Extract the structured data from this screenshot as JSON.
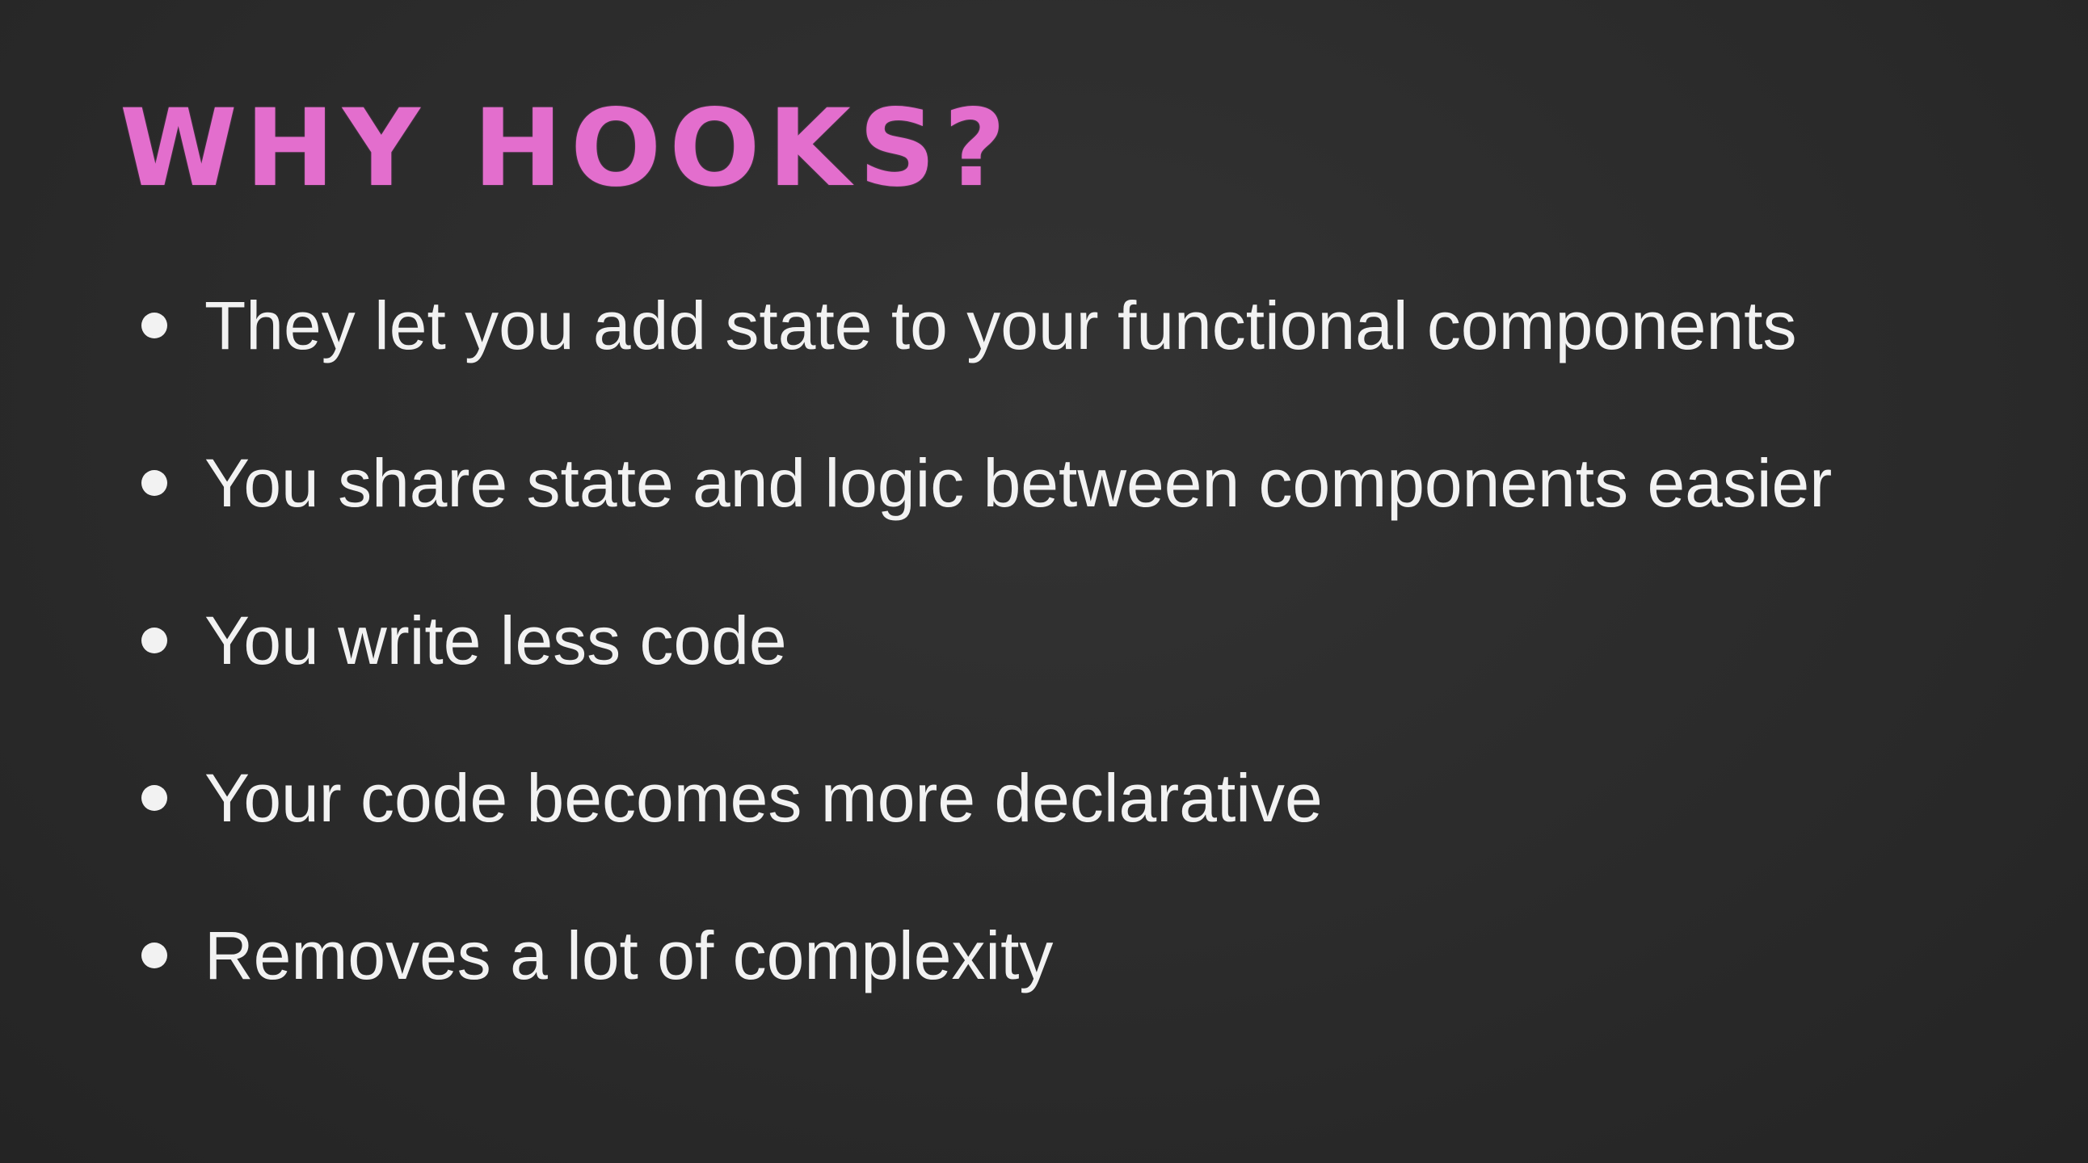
{
  "slide": {
    "title": "WHY HOOKS?",
    "title_color": "#e36ecd",
    "background_color": "#2b2b2b",
    "text_color": "#f2f2f2",
    "bullets": [
      "They let you add state to your functional components",
      "You share state and logic between components easier",
      "You write less code",
      "Your code becomes more declarative",
      "Removes a lot of complexity"
    ]
  }
}
